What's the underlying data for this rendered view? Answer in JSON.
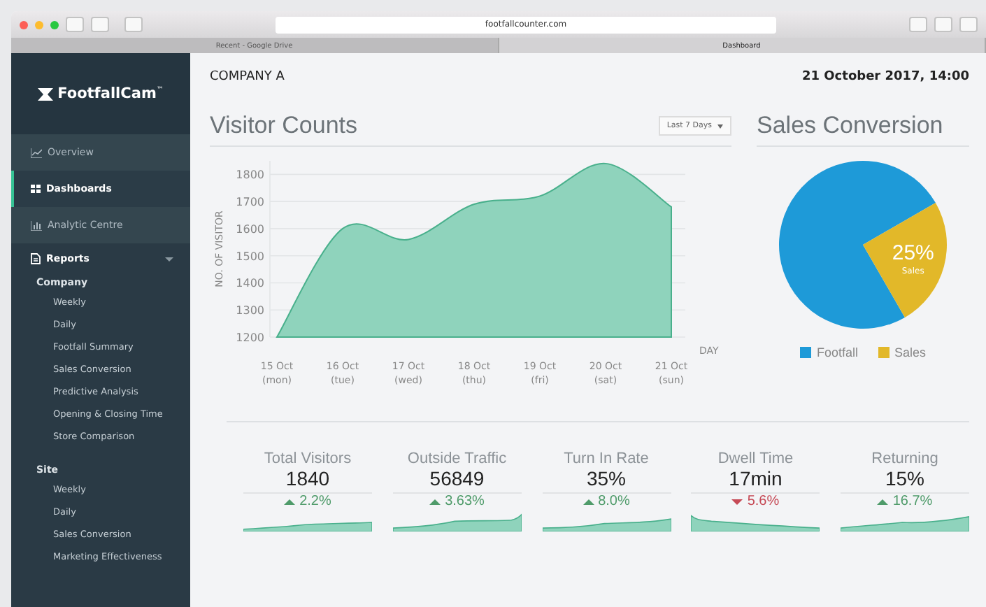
{
  "browser": {
    "address": "footfallcounter.com",
    "tabs": [
      {
        "label": "Recent - Google Drive",
        "selected": false
      },
      {
        "label": "Dashboard",
        "selected": true
      }
    ]
  },
  "sidebar": {
    "logo": "FootfallCam",
    "logo_mark": "™",
    "items": [
      {
        "label": "Overview",
        "selected": false
      },
      {
        "label": "Dashboards",
        "selected": true
      },
      {
        "label": "Analytic Centre",
        "selected": false
      },
      {
        "label": "Reports",
        "selected": false,
        "expanded": true,
        "children": [
          {
            "label": "Company",
            "children": [
              {
                "label": "Weekly"
              },
              {
                "label": "Daily"
              },
              {
                "label": "Footfall Summary"
              },
              {
                "label": "Sales Conversion"
              },
              {
                "label": "Predictive Analysis"
              },
              {
                "label": "Opening & Closing Time"
              },
              {
                "label": "Store Comparison"
              }
            ]
          },
          {
            "label": "Site",
            "children": [
              {
                "label": "Weekly"
              },
              {
                "label": "Daily"
              },
              {
                "label": "Sales Conversion"
              },
              {
                "label": "Marketing Effectiveness"
              }
            ]
          }
        ]
      }
    ]
  },
  "header": {
    "company": "COMPANY A",
    "datetime": "21 October 2017, 14:00"
  },
  "visitor_counts": {
    "title": "Visitor Counts",
    "range": "Last 7 Days",
    "chart_data": {
      "type": "area",
      "ylabel": "NO. OF VISITOR",
      "xlabel": "DAY",
      "categories": [
        {
          "date": "15 Oct",
          "day": "(mon)"
        },
        {
          "date": "16 Oct",
          "day": "(tue)"
        },
        {
          "date": "17 Oct",
          "day": "(wed)"
        },
        {
          "date": "18 Oct",
          "day": "(thu)"
        },
        {
          "date": "19 Oct",
          "day": "(fri)"
        },
        {
          "date": "20 Oct",
          "day": "(sat)"
        },
        {
          "date": "21 Oct",
          "day": "(sun)"
        }
      ],
      "series": [
        {
          "color": "#8fd3bc",
          "values": [
            1200,
            1600,
            1560,
            1690,
            1720,
            1840,
            1680
          ]
        }
      ],
      "grid": true,
      "ylim": [
        1200,
        1850
      ],
      "yticks": [
        1200,
        1300,
        1400,
        1500,
        1600,
        1700,
        1800
      ]
    }
  },
  "sales_conversion": {
    "title": "Sales Conversion",
    "chart_data": {
      "type": "pie",
      "categories": [
        "Footfall",
        "Sales"
      ],
      "series": [
        {
          "values": [
            75,
            25
          ]
        }
      ],
      "colors": [
        "#1e9ad8",
        "#e2b829"
      ],
      "value_labels": [
        null,
        "25%"
      ]
    }
  },
  "kpis": [
    {
      "label": "Total Visitors",
      "value": "1840",
      "change": "2.2%",
      "kind": "up"
    },
    {
      "label": "Outside Traffic",
      "value": "56849",
      "change": "3.63%",
      "kind": "up"
    },
    {
      "label": "Turn In Rate",
      "value": "35%",
      "change": "8.0%",
      "kind": "up"
    },
    {
      "label": "Dwell Time",
      "value": "17min",
      "change": "5.6%",
      "kind": "down"
    },
    {
      "label": "Returning",
      "value": "15%",
      "change": "16.7%",
      "kind": "up"
    }
  ]
}
